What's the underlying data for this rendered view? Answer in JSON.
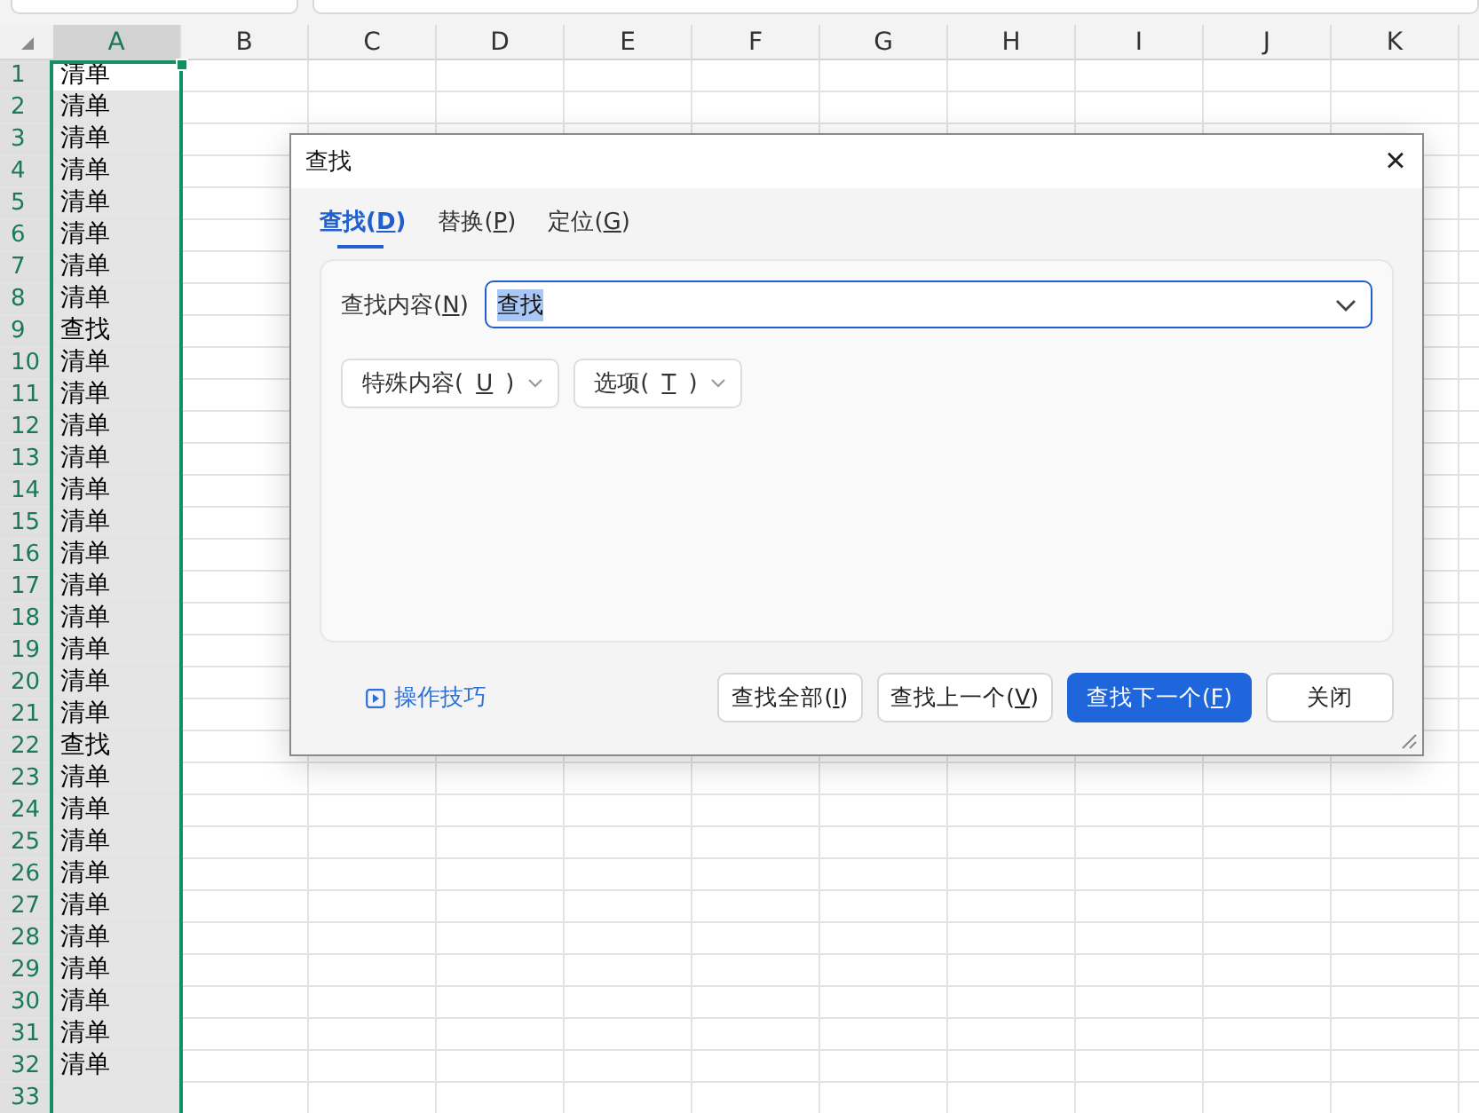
{
  "sheet": {
    "columns": [
      {
        "label": "A",
        "selected": true
      },
      {
        "label": "B",
        "selected": false
      },
      {
        "label": "C",
        "selected": false
      },
      {
        "label": "D",
        "selected": false
      },
      {
        "label": "E",
        "selected": false
      },
      {
        "label": "F",
        "selected": false
      },
      {
        "label": "G",
        "selected": false
      },
      {
        "label": "H",
        "selected": false
      },
      {
        "label": "I",
        "selected": false
      },
      {
        "label": "J",
        "selected": false
      },
      {
        "label": "K",
        "selected": false
      }
    ],
    "rows": [
      {
        "number": "1",
        "value": "清单",
        "active": true
      },
      {
        "number": "2",
        "value": "清单",
        "active": false
      },
      {
        "number": "3",
        "value": "清单",
        "active": false
      },
      {
        "number": "4",
        "value": "清单",
        "active": false
      },
      {
        "number": "5",
        "value": "清单",
        "active": false
      },
      {
        "number": "6",
        "value": "清单",
        "active": false
      },
      {
        "number": "7",
        "value": "清单",
        "active": false
      },
      {
        "number": "8",
        "value": "清单",
        "active": false
      },
      {
        "number": "9",
        "value": "查找",
        "active": false
      },
      {
        "number": "10",
        "value": "清单",
        "active": false
      },
      {
        "number": "11",
        "value": "清单",
        "active": false
      },
      {
        "number": "12",
        "value": "清单",
        "active": false
      },
      {
        "number": "13",
        "value": "清单",
        "active": false
      },
      {
        "number": "14",
        "value": "清单",
        "active": false
      },
      {
        "number": "15",
        "value": "清单",
        "active": false
      },
      {
        "number": "16",
        "value": "清单",
        "active": false
      },
      {
        "number": "17",
        "value": "清单",
        "active": false
      },
      {
        "number": "18",
        "value": "清单",
        "active": false
      },
      {
        "number": "19",
        "value": "清单",
        "active": false
      },
      {
        "number": "20",
        "value": "清单",
        "active": false
      },
      {
        "number": "21",
        "value": "清单",
        "active": false
      },
      {
        "number": "22",
        "value": "查找",
        "active": false
      },
      {
        "number": "23",
        "value": "清单",
        "active": false
      },
      {
        "number": "24",
        "value": "清单",
        "active": false
      },
      {
        "number": "25",
        "value": "清单",
        "active": false
      },
      {
        "number": "26",
        "value": "清单",
        "active": false
      },
      {
        "number": "27",
        "value": "清单",
        "active": false
      },
      {
        "number": "28",
        "value": "清单",
        "active": false
      },
      {
        "number": "29",
        "value": "清单",
        "active": false
      },
      {
        "number": "30",
        "value": "清单",
        "active": false
      },
      {
        "number": "31",
        "value": "清单",
        "active": false
      },
      {
        "number": "32",
        "value": "清单",
        "active": false
      },
      {
        "number": "33",
        "active": false
      }
    ]
  },
  "dialog": {
    "title": "查找",
    "close": "×",
    "tabs": [
      {
        "text": "查找(",
        "key": "D",
        "end": ")",
        "selected": true
      },
      {
        "text": "替换(",
        "key": "P",
        "end": ")",
        "selected": false
      },
      {
        "text": "定位(",
        "key": "G",
        "end": ")",
        "selected": false
      }
    ],
    "find_field": {
      "label": {
        "text": "查找内容(",
        "key": "N",
        "end": ")"
      },
      "value": "查找",
      "text_selected": true
    },
    "dropdowns": [
      {
        "text": "特殊内容(",
        "key": "U",
        "end": ")"
      },
      {
        "text": "选项(",
        "key": "T",
        "end": ")"
      }
    ],
    "tips_link": "操作技巧",
    "buttons": [
      {
        "text": "查找全部(",
        "key": "I",
        "end": ")",
        "kind": "normal"
      },
      {
        "text": "查找上一个(",
        "key": "V",
        "end": ")",
        "kind": "normal"
      },
      {
        "text": "查找下一个(",
        "key": "F",
        "end": ")",
        "kind": "primary"
      },
      {
        "text": "关闭",
        "kind": "normal"
      }
    ]
  }
}
